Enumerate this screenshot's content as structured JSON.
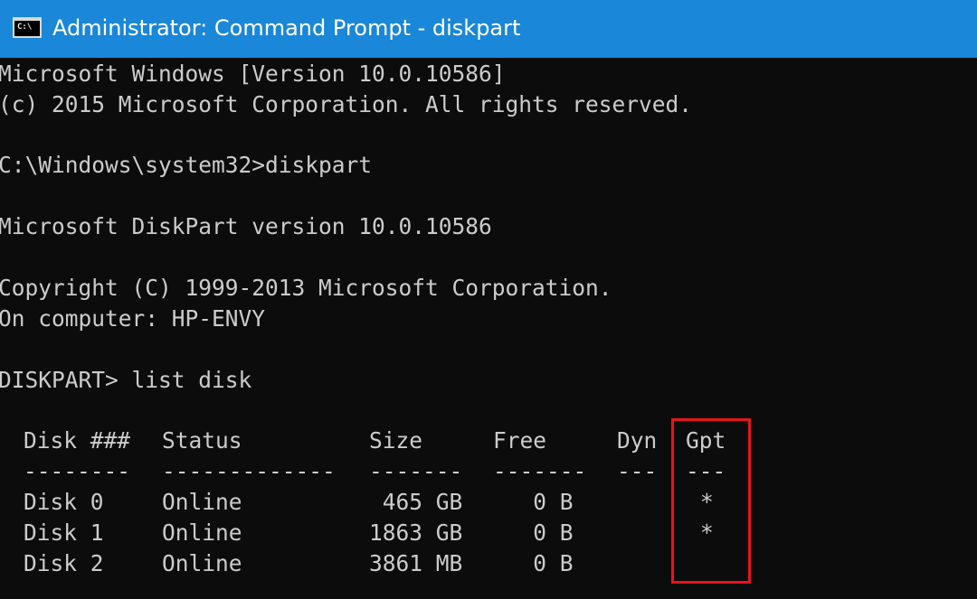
{
  "window": {
    "title": "Administrator: Command Prompt - diskpart",
    "icon_label": "C:\\",
    "icon": "console-icon"
  },
  "console": {
    "lines": [
      "Microsoft Windows [Version 10.0.10586]",
      "(c) 2015 Microsoft Corporation. All rights reserved.",
      "C:\\Windows\\system32>diskpart",
      "Microsoft DiskPart version 10.0.10586",
      "Copyright (C) 1999-2013 Microsoft Corporation.",
      "On computer: HP-ENVY",
      "DISKPART> list disk"
    ]
  },
  "disk_table": {
    "headers": {
      "disk": "Disk ###",
      "status": "Status",
      "size": "Size",
      "free": "Free",
      "dyn": "Dyn",
      "gpt": "Gpt"
    },
    "separators": {
      "disk": "--------",
      "status": "-------------",
      "size": "-------",
      "free": "-------",
      "dyn": "---",
      "gpt": "---"
    },
    "rows": [
      {
        "disk": "Disk 0",
        "status": "Online",
        "size": " 465 GB",
        "free": "   0 B",
        "dyn": "",
        "gpt": "*"
      },
      {
        "disk": "Disk 1",
        "status": "Online",
        "size": "1863 GB",
        "free": "   0 B",
        "dyn": "",
        "gpt": "*"
      },
      {
        "disk": "Disk 2",
        "status": "Online",
        "size": "3861 MB",
        "free": "   0 B",
        "dyn": "",
        "gpt": ""
      }
    ]
  },
  "colors": {
    "titlebar": "#1a87d8",
    "console_bg": "#0c0c0c",
    "console_text": "#cccccc",
    "highlight": "#e8141b"
  }
}
